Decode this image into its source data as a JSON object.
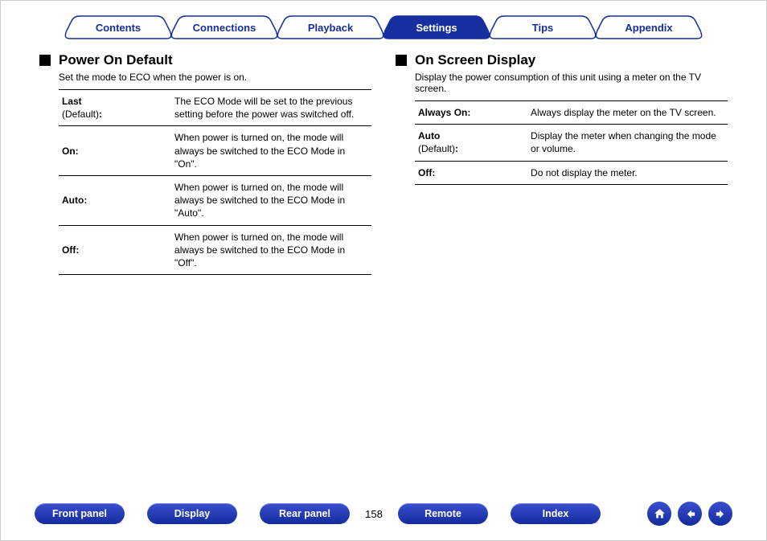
{
  "tabs": {
    "items": [
      {
        "label": "Contents",
        "active": false
      },
      {
        "label": "Connections",
        "active": false
      },
      {
        "label": "Playback",
        "active": false
      },
      {
        "label": "Settings",
        "active": true
      },
      {
        "label": "Tips",
        "active": false
      },
      {
        "label": "Appendix",
        "active": false
      }
    ]
  },
  "left": {
    "title": "Power On Default",
    "desc": "Set the mode to ECO when the power is on.",
    "rows": [
      {
        "name": "Last",
        "default": "(Default):",
        "desc": "The ECO Mode will be set to the previous setting before the power was switched off."
      },
      {
        "name": "On:",
        "default": "",
        "desc": "When power is turned on, the mode will always be switched to the ECO Mode in \"On\"."
      },
      {
        "name": "Auto:",
        "default": "",
        "desc": "When power is turned on, the mode will always be switched to the ECO Mode in \"Auto\"."
      },
      {
        "name": "Off:",
        "default": "",
        "desc": "When power is turned on, the mode will always be switched to the ECO Mode in \"Off\"."
      }
    ]
  },
  "right": {
    "title": "On Screen Display",
    "desc": "Display the power consumption of this unit using a meter on the TV screen.",
    "rows": [
      {
        "name": "Always On:",
        "default": "",
        "desc": "Always display the meter on the TV screen."
      },
      {
        "name": "Auto",
        "default": "(Default):",
        "desc": "Display the meter when changing the mode or volume."
      },
      {
        "name": "Off:",
        "default": "",
        "desc": "Do not display the meter."
      }
    ]
  },
  "footer": {
    "buttons": {
      "front_panel": "Front panel",
      "display": "Display",
      "rear_panel": "Rear panel",
      "remote": "Remote",
      "index": "Index"
    },
    "page": "158"
  }
}
